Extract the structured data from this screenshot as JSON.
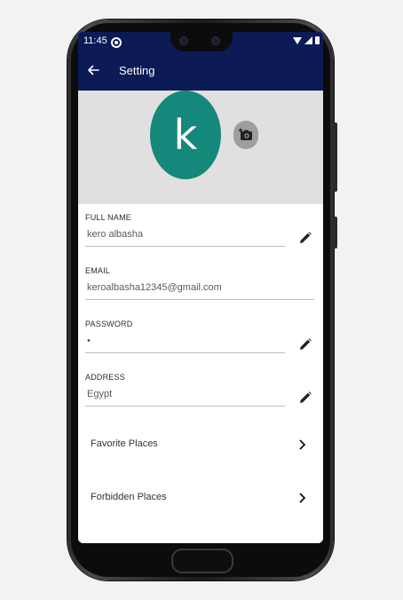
{
  "status_bar": {
    "time": "11:45"
  },
  "app_bar": {
    "title": "Setting"
  },
  "profile": {
    "avatar_letter": "k",
    "avatar_color": "#14887a"
  },
  "fields": [
    {
      "label": "FULL NAME",
      "value": "kero albasha",
      "editable": true
    },
    {
      "label": "EMAIL",
      "value": "keroalbasha12345@gmail.com",
      "editable": false
    },
    {
      "label": "PASSWORD",
      "value": "•",
      "editable": true
    },
    {
      "label": "ADDRESS",
      "value": "Egypt",
      "editable": true
    }
  ],
  "nav_items": [
    {
      "label": "Favorite Places"
    },
    {
      "label": "Forbidden Places"
    }
  ],
  "colors": {
    "app_bar": "#0c1a55",
    "header_bg": "#e0e0e0"
  }
}
